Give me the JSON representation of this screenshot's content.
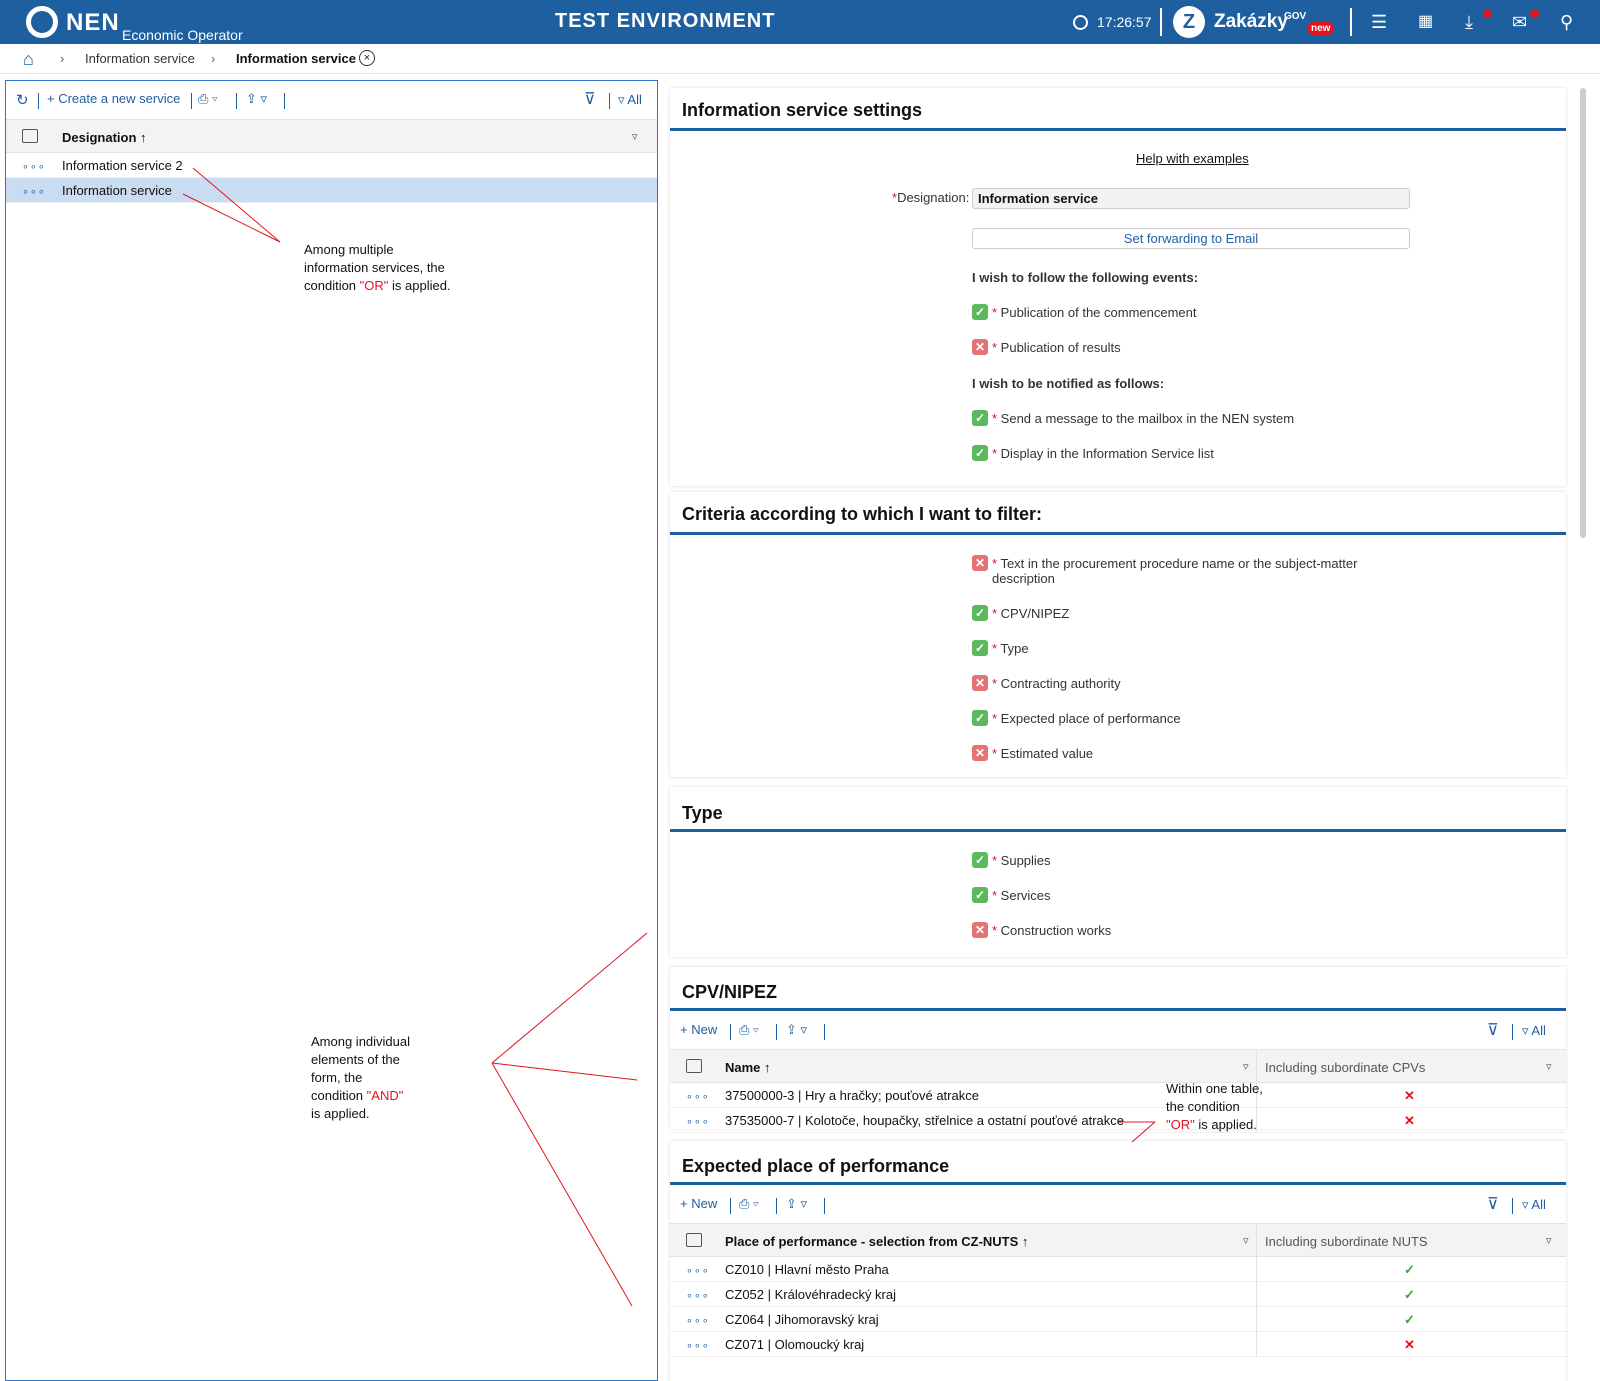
{
  "topbar": {
    "logo": "NEN",
    "logo_sub": "Economic Operator",
    "environment": "TEST ENVIRONMENT",
    "time": "17:26:57",
    "zakazky": "Zakázky",
    "gov": "GOV",
    "new_badge": "new"
  },
  "breadcrumb": {
    "items": [
      "Information service",
      "Information service"
    ]
  },
  "left": {
    "create_label": "Create a new service",
    "all_label": "All",
    "column": "Designation",
    "rows": [
      "Information service 2",
      "Information service"
    ]
  },
  "settings": {
    "title": "Information service settings",
    "help_link": "Help with examples",
    "designation_label": "Designation:",
    "designation_value": "Information service",
    "forward_button": "Set forwarding to Email",
    "events_heading": "I wish to follow the following events:",
    "events": [
      {
        "label": "Publication of the commencement",
        "checked": true
      },
      {
        "label": "Publication of results",
        "checked": false
      }
    ],
    "notify_heading": "I wish to be notified as follows:",
    "notify": [
      {
        "label": "Send a message to the mailbox in the NEN system",
        "checked": true
      },
      {
        "label": "Display in the Information Service list",
        "checked": true
      }
    ]
  },
  "criteria": {
    "title": "Criteria according to which I want to filter:",
    "items": [
      {
        "label": "Text in the procurement procedure name or the subject-matter description",
        "checked": false
      },
      {
        "label": "CPV/NIPEZ",
        "checked": true
      },
      {
        "label": "Type",
        "checked": true
      },
      {
        "label": "Contracting authority",
        "checked": false
      },
      {
        "label": "Expected place of performance",
        "checked": true
      },
      {
        "label": "Estimated value",
        "checked": false
      }
    ]
  },
  "type": {
    "title": "Type",
    "items": [
      {
        "label": "Supplies",
        "checked": true
      },
      {
        "label": "Services",
        "checked": true
      },
      {
        "label": "Construction works",
        "checked": false
      }
    ]
  },
  "cpv": {
    "title": "CPV/NIPEZ",
    "new_label": "New",
    "all_label": "All",
    "col1": "Name",
    "col2": "Including subordinate CPVs",
    "rows": [
      {
        "name": "37500000-3 | Hry a hračky; pouťové atrakce",
        "sub": false
      },
      {
        "name": "37535000-7 | Kolotoče, houpačky, střelnice a ostatní pouťové atrakce",
        "sub": false
      }
    ]
  },
  "place": {
    "title": "Expected place of performance",
    "new_label": "New",
    "all_label": "All",
    "col1": "Place of performance - selection from CZ-NUTS",
    "col2": "Including subordinate NUTS",
    "rows": [
      {
        "name": "CZ010 | Hlavní město Praha",
        "sub": true
      },
      {
        "name": "CZ052 | Královéhradecký kraj",
        "sub": true
      },
      {
        "name": "CZ064 | Jihomoravský kraj",
        "sub": true
      },
      {
        "name": "CZ071 | Olomoucký kraj",
        "sub": false
      }
    ]
  },
  "annotations": {
    "or_services": {
      "l1": "Among multiple",
      "l2": "information services, the",
      "l3a": "condition ",
      "l3b": "\"OR\"",
      "l3c": " is applied."
    },
    "and_form": {
      "l1": "Among individual",
      "l2": "elements of the",
      "l3": "form, the",
      "l4a": "condition ",
      "l4b": "\"AND\"",
      "l5": "is applied."
    },
    "or_table": {
      "l1": "Within one table,",
      "l2": "the condition",
      "l3a": "\"OR\"",
      "l3b": " is applied."
    }
  },
  "colors": {
    "brand": "#1e5fa0",
    "check_on": "#5bb85b",
    "check_off": "#e57373",
    "annotation": "#e0141e"
  }
}
